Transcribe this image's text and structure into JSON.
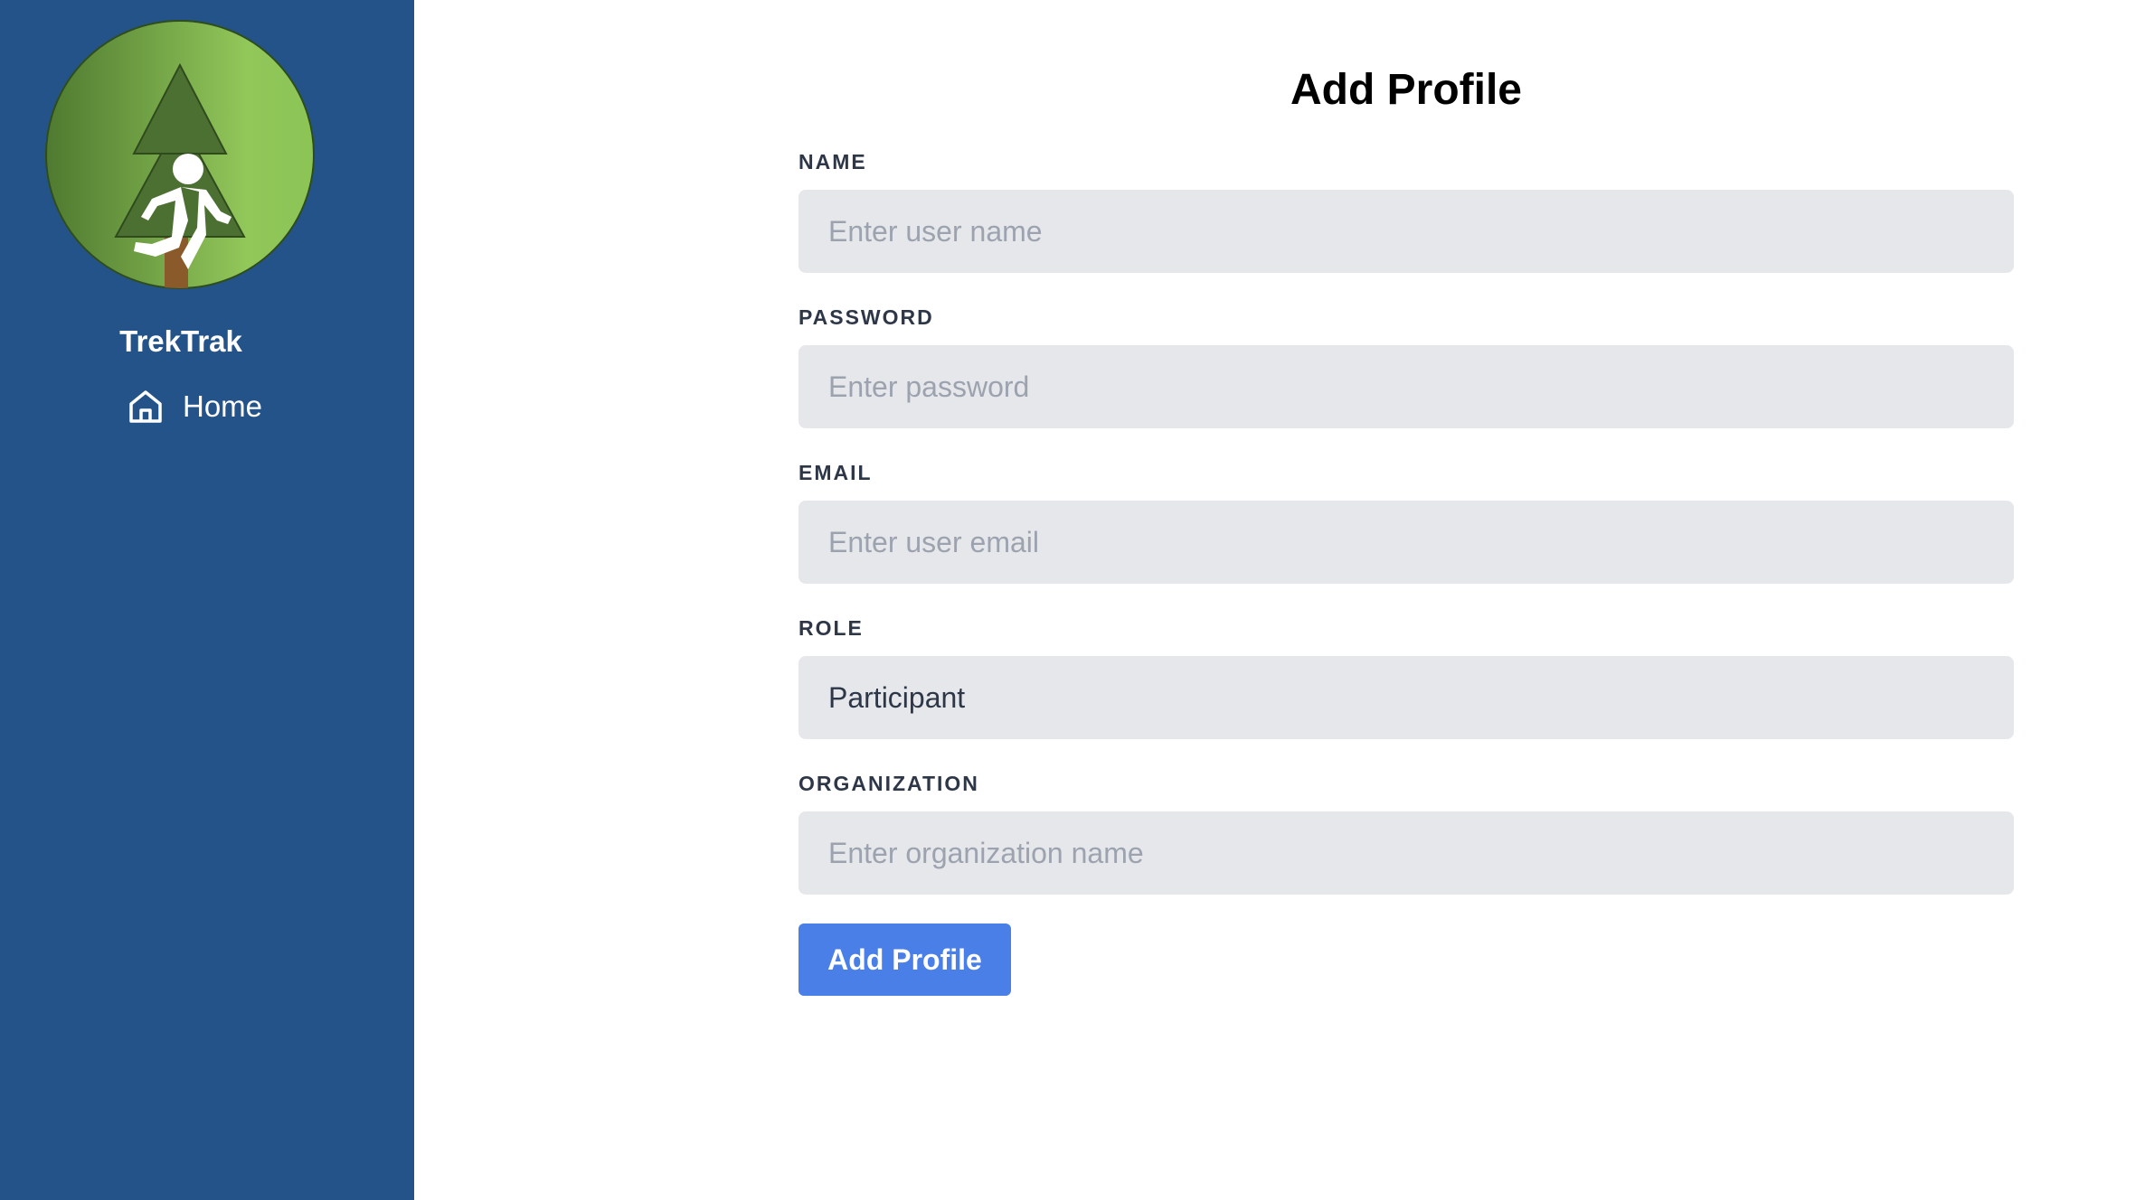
{
  "sidebar": {
    "brand": "TrekTrak",
    "logo_icon": "hiker-tree-logo-icon",
    "nav": [
      {
        "label": "Home",
        "icon": "home-icon"
      }
    ]
  },
  "main": {
    "title": "Add Profile",
    "fields": {
      "name": {
        "label": "NAME",
        "placeholder": "Enter user name",
        "value": ""
      },
      "password": {
        "label": "PASSWORD",
        "placeholder": "Enter password",
        "value": ""
      },
      "email": {
        "label": "EMAIL",
        "placeholder": "Enter user email",
        "value": ""
      },
      "role": {
        "label": "ROLE",
        "value": "Participant"
      },
      "organization": {
        "label": "ORGANIZATION",
        "placeholder": "Enter organization name",
        "value": ""
      }
    },
    "submit_label": "Add Profile"
  },
  "colors": {
    "sidebar_bg": "#245389",
    "input_bg": "#e5e7eb",
    "button_bg": "#4a7fe8",
    "label_text": "#2d3748",
    "placeholder_text": "#9ca3af"
  }
}
